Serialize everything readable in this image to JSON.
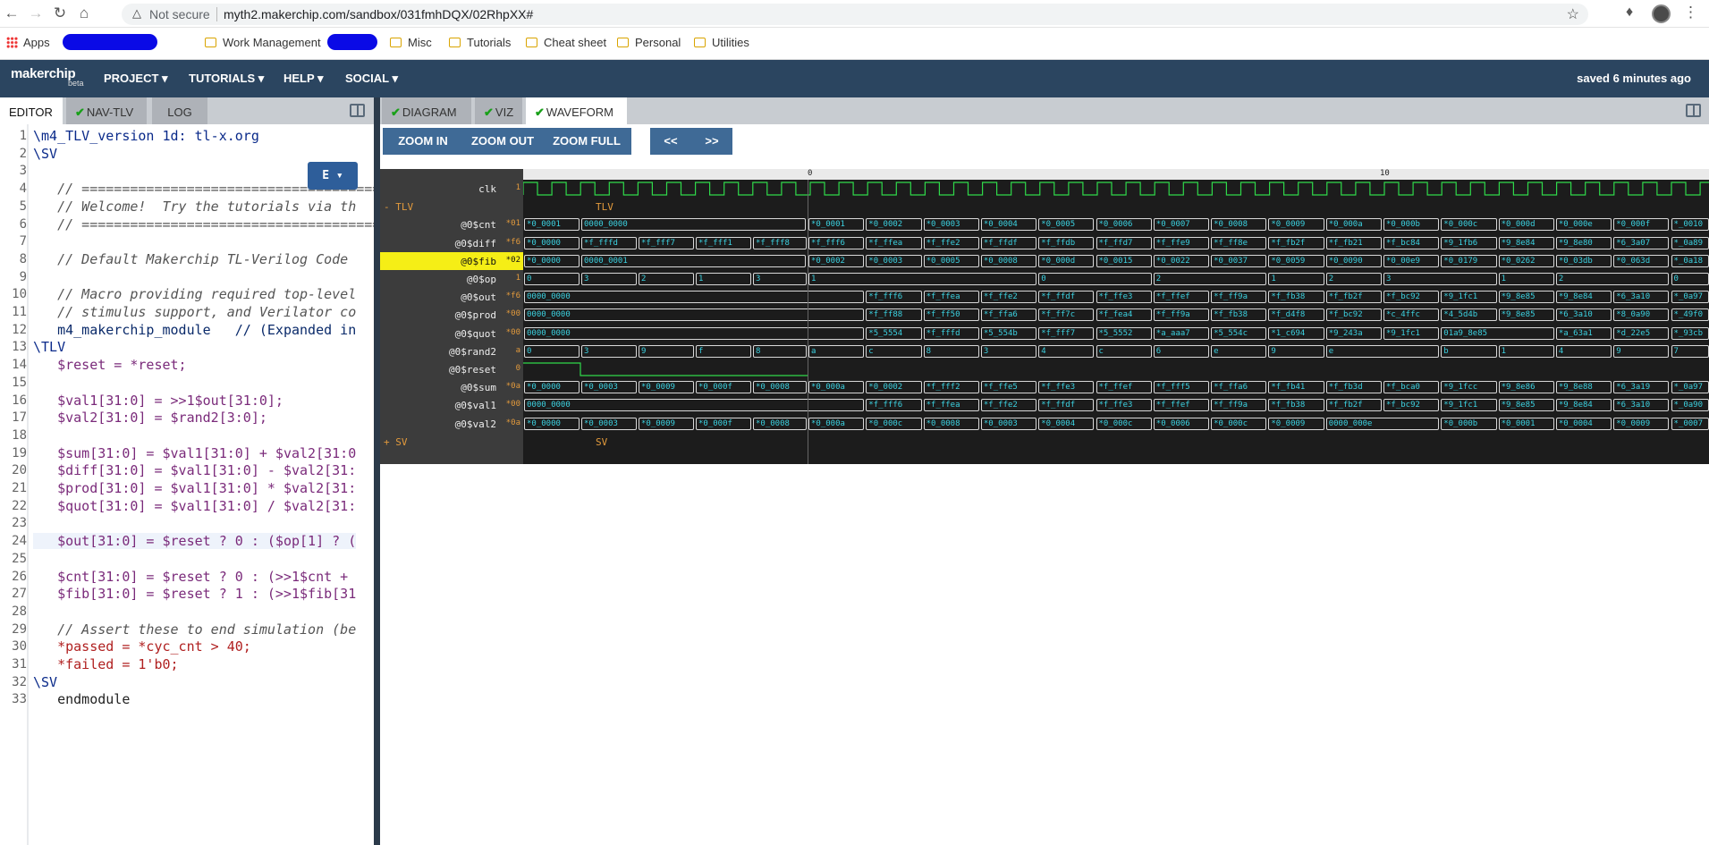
{
  "browser": {
    "security": "Not secure",
    "url": "myth2.makerchip.com/sandbox/031fmhDQX/02RhpXX#",
    "bookmarks": [
      "Apps",
      "Work Management",
      "Misc",
      "Tutorials",
      "Cheat sheet",
      "Personal",
      "Utilities"
    ]
  },
  "header": {
    "logo": "makerchip",
    "beta": "beta",
    "menus": [
      "PROJECT ▾",
      "TUTORIALS ▾",
      "HELP ▾",
      "SOCIAL ▾"
    ],
    "saved": "saved 6 minutes ago"
  },
  "left_tabs": {
    "editor": "EDITOR",
    "navtlv": "NAV-TLV",
    "log": "LOG"
  },
  "editor": {
    "e_button": "E ▾",
    "lines": [
      "\\m4_TLV_version 1d: tl-x.org",
      "\\SV",
      "",
      "   // =======================================",
      "   // Welcome!  Try the tutorials via th",
      "   // =======================================",
      "",
      "   // Default Makerchip TL-Verilog Code",
      "",
      "   // Macro providing required top-level",
      "   // stimulus support, and Verilator co",
      "   m4_makerchip_module   // (Expanded in",
      "\\TLV",
      "   $reset = *reset;",
      "",
      "   $val1[31:0] = >>1$out[31:0];",
      "   $val2[31:0] = $rand2[3:0];",
      "",
      "   $sum[31:0] = $val1[31:0] + $val2[31:0",
      "   $diff[31:0] = $val1[31:0] - $val2[31:",
      "   $prod[31:0] = $val1[31:0] * $val2[31:",
      "   $quot[31:0] = $val1[31:0] / $val2[31:",
      "",
      "   $out[31:0] = $reset ? 0 : ($op[1] ? (",
      "",
      "   $cnt[31:0] = $reset ? 0 : (>>1$cnt +",
      "   $fib[31:0] = $reset ? 1 : (>>1$fib[31",
      "",
      "   // Assert these to end simulation (be",
      "   *passed = *cyc_cnt > 40;",
      "   *failed = 1'b0;",
      "\\SV",
      "   endmodule"
    ]
  },
  "right_tabs": {
    "diagram": "DIAGRAM",
    "viz": "VIZ",
    "waveform": "WAVEFORM"
  },
  "toolbar": {
    "zoom_in": "ZOOM IN",
    "zoom_out": "ZOOM OUT",
    "zoom_full": "ZOOM FULL",
    "prev": "<<",
    "next": ">>"
  },
  "waveform": {
    "ticks": [
      "0",
      "10"
    ],
    "groups": {
      "tlv": "- TLV",
      "sv": "+ SV",
      "tlv_label": "TLV",
      "sv_label": "SV"
    },
    "clk": {
      "name": "clk",
      "val": "1"
    },
    "signals": [
      {
        "name": "@0$cnt",
        "val": "*01",
        "highlight": false,
        "pre": [
          "*0_0001",
          "0000_0000"
        ],
        "post": [
          "*0_0001",
          "*0_0002",
          "*0_0003",
          "*0_0004",
          "*0_0005",
          "*0_0006",
          "*0_0007",
          "*0_0008",
          "*0_0009",
          "*0_000a",
          "*0_000b",
          "*0_000c",
          "*0_000d",
          "*0_000e",
          "*0_000f",
          "*_0010"
        ]
      },
      {
        "name": "@0$diff",
        "val": "*f6",
        "highlight": false,
        "pre": [
          "*0_0000",
          "*f_fffd",
          "*f_fff7",
          "*f_fff1",
          "*f_fff8"
        ],
        "post": [
          "*f_fff6",
          "*f_ffea",
          "*f_ffe2",
          "*f_ffdf",
          "*f_ffdb",
          "*f_ffd7",
          "*f_ffe9",
          "*f_ff8e",
          "*f_fb2f",
          "*f_fb21",
          "*f_bc84",
          "*9_1fb6",
          "*9_8e84",
          "*9_8e80",
          "*6_3a07",
          "*_0a89"
        ]
      },
      {
        "name": "@0$fib",
        "val": "*02",
        "highlight": true,
        "pre": [
          "*0_0000",
          "0000_0001"
        ],
        "post": [
          "*0_0002",
          "*0_0003",
          "*0_0005",
          "*0_0008",
          "*0_000d",
          "*0_0015",
          "*0_0022",
          "*0_0037",
          "*0_0059",
          "*0_0090",
          "*0_00e9",
          "*0_0179",
          "*0_0262",
          "*0_03db",
          "*0_063d",
          "*_0a18"
        ]
      },
      {
        "name": "@0$op",
        "val": "1",
        "highlight": false,
        "pre": [
          "0",
          "3",
          "2",
          "1",
          "3"
        ],
        "post": [
          "1",
          "",
          "",
          "",
          "0",
          "",
          "2",
          "",
          "1",
          "2",
          "3",
          "",
          "1",
          "2",
          "",
          "0"
        ]
      },
      {
        "name": "@0$out",
        "val": "*f6",
        "highlight": false,
        "pre": [
          "0000_0000"
        ],
        "post": [
          "",
          "*f_fff6",
          "*f_ffea",
          "*f_ffe2",
          "*f_ffdf",
          "*f_ffe3",
          "*f_ffef",
          "*f_ff9a",
          "*f_fb38",
          "*f_fb2f",
          "*f_bc92",
          "*9_1fc1",
          "*9_8e85",
          "*9_8e84",
          "*6_3a10",
          "*_0a97"
        ]
      },
      {
        "name": "@0$prod",
        "val": "*00",
        "highlight": false,
        "pre": [
          "0000_0000"
        ],
        "post": [
          "",
          "*f_ff88",
          "*f_ff50",
          "*f_ffa6",
          "*f_ff7c",
          "*f_fea4",
          "*f_ff9a",
          "*f_fb38",
          "*f_d4f8",
          "*f_bc92",
          "*c_4ffc",
          "*4_5d4b",
          "*9_8e85",
          "*6_3a10",
          "*8_0a90",
          "*_49f0"
        ]
      },
      {
        "name": "@0$quot",
        "val": "*00",
        "highlight": false,
        "pre": [
          "0000_0000"
        ],
        "post": [
          "",
          "*5_5554",
          "*f_fffd",
          "*5_554b",
          "*f_fff7",
          "*5_5552",
          "*a_aaa7",
          "*5_554c",
          "*1_c694",
          "*9_243a",
          "*9_1fc1",
          "01a9_8e85",
          "",
          "*a_63a1",
          "*d_22e5",
          "*_93cb"
        ]
      },
      {
        "name": "@0$rand2",
        "val": "a",
        "highlight": false,
        "pre": [
          "0",
          "3",
          "9",
          "f",
          "8"
        ],
        "post": [
          "a",
          "c",
          "8",
          "3",
          "4",
          "c",
          "6",
          "e",
          "9",
          "e",
          "",
          "b",
          "1",
          "4",
          "9",
          "7"
        ]
      },
      {
        "name": "@0$reset",
        "val": "0",
        "highlight": false,
        "pre": [],
        "post": []
      },
      {
        "name": "@0$sum",
        "val": "*0a",
        "highlight": false,
        "pre": [
          "*0_0000",
          "*0_0003",
          "*0_0009",
          "*0_000f",
          "*0_0008"
        ],
        "post": [
          "*0_000a",
          "*0_0002",
          "*f_fff2",
          "*f_ffe5",
          "*f_ffe3",
          "*f_ffef",
          "*f_fff5",
          "*f_ffa6",
          "*f_fb41",
          "*f_fb3d",
          "*f_bca0",
          "*9_1fcc",
          "*9_8e86",
          "*9_8e88",
          "*6_3a19",
          "*_0a97"
        ]
      },
      {
        "name": "@0$val1",
        "val": "*00",
        "highlight": false,
        "pre": [
          "0000_0000"
        ],
        "post": [
          "",
          "*f_fff6",
          "*f_ffea",
          "*f_ffe2",
          "*f_ffdf",
          "*f_ffe3",
          "*f_ffef",
          "*f_ff9a",
          "*f_fb38",
          "*f_fb2f",
          "*f_bc92",
          "*9_1fc1",
          "*9_8e85",
          "*9_8e84",
          "*6_3a10",
          "*_0a90"
        ]
      },
      {
        "name": "@0$val2",
        "val": "*0a",
        "highlight": false,
        "pre": [
          "*0_0000",
          "*0_0003",
          "*0_0009",
          "*0_000f",
          "*0_0008"
        ],
        "post": [
          "*0_000a",
          "*0_000c",
          "*0_0008",
          "*0_0003",
          "*0_0004",
          "*0_000c",
          "*0_0006",
          "*0_000c",
          "*0_0009",
          "0000_000e",
          "",
          "*0_000b",
          "*0_0001",
          "*0_0004",
          "*0_0009",
          "*_0007"
        ]
      }
    ]
  }
}
